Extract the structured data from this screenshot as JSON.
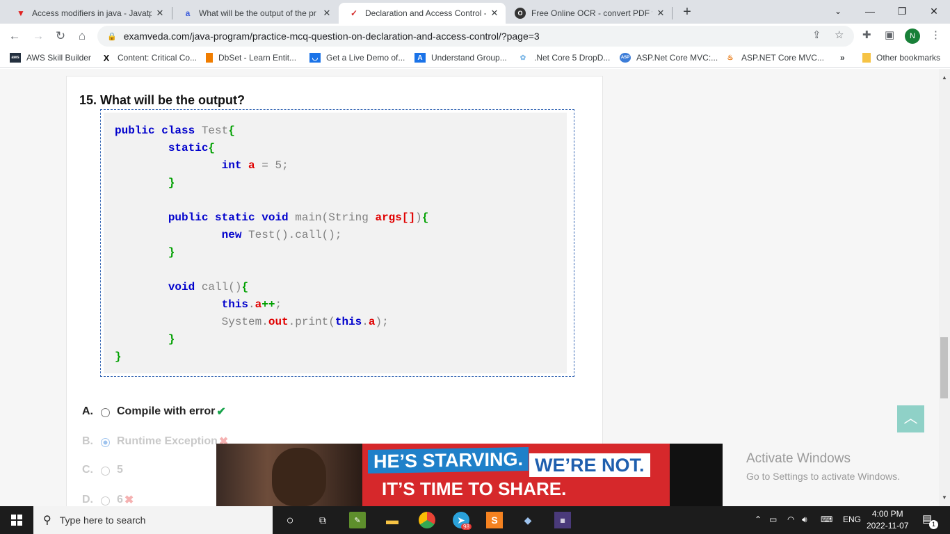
{
  "browser": {
    "tabs": [
      {
        "title": "Access modifiers in java - Javatpo",
        "favicon": "javatpoint-icon",
        "active": false
      },
      {
        "title": "What will be the output of the pr",
        "favicon": "site-icon",
        "active": false
      },
      {
        "title": "Declaration and Access Control - ",
        "favicon": "examveda-icon",
        "active": true
      },
      {
        "title": "Free Online OCR - convert PDF to",
        "favicon": "ocr-icon",
        "active": false
      }
    ],
    "url": "examveda.com/java-program/practice-mcq-question-on-declaration-and-access-control/?page=3",
    "profile_initial": "N",
    "bookmarks": [
      {
        "label": "AWS Skill Builder",
        "icon": "aws-icon"
      },
      {
        "label": "Content: Critical Co...",
        "icon": "x-icon"
      },
      {
        "label": "DbSet - Learn Entit...",
        "icon": "bookmark-icon"
      },
      {
        "label": "Get a Live Demo of...",
        "icon": "smile-icon"
      },
      {
        "label": "Understand Group...",
        "icon": "a-icon"
      },
      {
        "label": ".Net Core 5 DropD...",
        "icon": "gear-icon"
      },
      {
        "label": "ASP.Net Core MVC:...",
        "icon": "asp-icon"
      },
      {
        "label": "ASP.NET Core MVC...",
        "icon": "java-icon"
      }
    ],
    "more_bookmarks": "»",
    "other_bookmarks": "Other bookmarks"
  },
  "question": {
    "title": "15. What will be the output?",
    "options": [
      {
        "letter": "A.",
        "text": "Compile with error",
        "mark": "✔"
      },
      {
        "letter": "B.",
        "text": "Runtime Exception",
        "mark": "✖"
      },
      {
        "letter": "C.",
        "text": "5",
        "mark": ""
      },
      {
        "letter": "D.",
        "text": "6",
        "mark": "✖"
      }
    ]
  },
  "ad": {
    "line1a": "HE’S STARVING.",
    "line1b": "WE’RE NOT.",
    "line2": "IT’S TIME TO SHARE."
  },
  "watermark": {
    "title": "Activate Windows",
    "subtitle": "Go to Settings to activate Windows."
  },
  "taskbar": {
    "search_placeholder": "Type here to search",
    "badge": "98",
    "lang": "ENG",
    "time": "4:00 PM",
    "date": "2022-11-07",
    "notifications": "1"
  },
  "colors": {
    "keyword": "#0000cc",
    "brace": "#00a000",
    "identifier": "#e00000",
    "correct": "#17a34a",
    "wrong": "#f5b1b1"
  }
}
